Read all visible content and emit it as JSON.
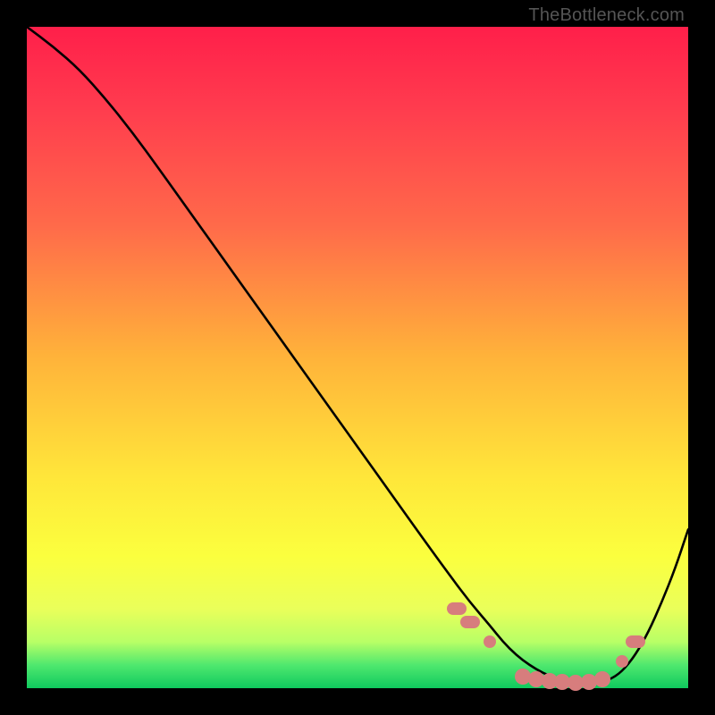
{
  "attribution": "TheBottleneck.com",
  "colors": {
    "gradient_stops": [
      {
        "offset": 0.0,
        "color": "#ff1f4a"
      },
      {
        "offset": 0.12,
        "color": "#ff3b4e"
      },
      {
        "offset": 0.3,
        "color": "#ff6a4a"
      },
      {
        "offset": 0.5,
        "color": "#ffb33a"
      },
      {
        "offset": 0.68,
        "color": "#ffe63a"
      },
      {
        "offset": 0.8,
        "color": "#fbff3e"
      },
      {
        "offset": 0.88,
        "color": "#eaff5a"
      },
      {
        "offset": 0.93,
        "color": "#b8ff66"
      },
      {
        "offset": 0.965,
        "color": "#4fe86e"
      },
      {
        "offset": 1.0,
        "color": "#0fc95e"
      }
    ],
    "curve": "#000000",
    "marker": "#d77d7d",
    "background": "#000000",
    "attribution": "#555555"
  },
  "chart_data": {
    "type": "line",
    "title": "",
    "xlabel": "",
    "ylabel": "",
    "xlim": [
      0,
      100
    ],
    "ylim": [
      0,
      100
    ],
    "grid": false,
    "legend": false,
    "series": [
      {
        "name": "curve",
        "x": [
          0,
          4,
          8,
          12,
          16,
          20,
          25,
          30,
          35,
          40,
          45,
          50,
          55,
          60,
          64,
          67,
          70,
          72,
          74,
          76,
          78,
          80,
          82,
          84,
          86,
          88,
          90,
          92,
          94,
          96,
          98,
          100
        ],
        "y": [
          100,
          97,
          93.5,
          89,
          84,
          78.5,
          71.5,
          64.5,
          57.5,
          50.5,
          43.5,
          36.5,
          29.5,
          22.5,
          17,
          13,
          9.5,
          7,
          5,
          3.5,
          2.3,
          1.5,
          1.0,
          0.8,
          0.8,
          1.2,
          2.5,
          5,
          8.5,
          13,
          18,
          24
        ]
      }
    ],
    "markers": [
      {
        "x": 65,
        "y": 12,
        "shape": "oval"
      },
      {
        "x": 67,
        "y": 10,
        "shape": "oval"
      },
      {
        "x": 70,
        "y": 7,
        "shape": "small"
      },
      {
        "x": 75,
        "y": 1.8,
        "shape": "big"
      },
      {
        "x": 77,
        "y": 1.4,
        "shape": "big"
      },
      {
        "x": 79,
        "y": 1.1,
        "shape": "big"
      },
      {
        "x": 81,
        "y": 0.9,
        "shape": "big"
      },
      {
        "x": 83,
        "y": 0.8,
        "shape": "big"
      },
      {
        "x": 85,
        "y": 0.9,
        "shape": "big"
      },
      {
        "x": 87,
        "y": 1.3,
        "shape": "big"
      },
      {
        "x": 90,
        "y": 4.0,
        "shape": "small"
      },
      {
        "x": 92,
        "y": 7.0,
        "shape": "oval"
      }
    ]
  }
}
